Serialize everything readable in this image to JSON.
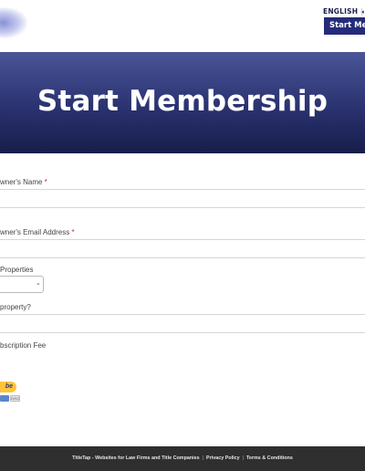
{
  "header": {
    "language": "ENGLISH",
    "language_caret": "◂",
    "start_button": "Start Membership"
  },
  "hero": {
    "title": "Start Membership"
  },
  "form": {
    "owner_name_label": "wner's Name",
    "owner_email_label": "wner's Email Address",
    "required_mark": "*",
    "properties_label": "Properties",
    "property_question_label": "property?",
    "subscription_fee_label": "bscription Fee",
    "properties_select_value": ""
  },
  "paypal": {
    "button_label": "be",
    "cards_label": "DISC"
  },
  "footer": {
    "brand": "TitleTap - Websites for Law Firms and Title Companies",
    "separator": "|",
    "privacy": "Privacy Policy",
    "terms": "Terms & Conditions"
  },
  "colors": {
    "accent": "#242c7a",
    "hero_top": "#4a5598",
    "hero_bottom": "#171d4a",
    "required": "#d0202a",
    "footer_bg": "#2f2f2f",
    "paypal_yellow": "#ffc439"
  },
  "icons": {
    "logo": "site-logo",
    "language_caret": "caret-left-icon",
    "select_chevron": "chevron-down-icon"
  }
}
